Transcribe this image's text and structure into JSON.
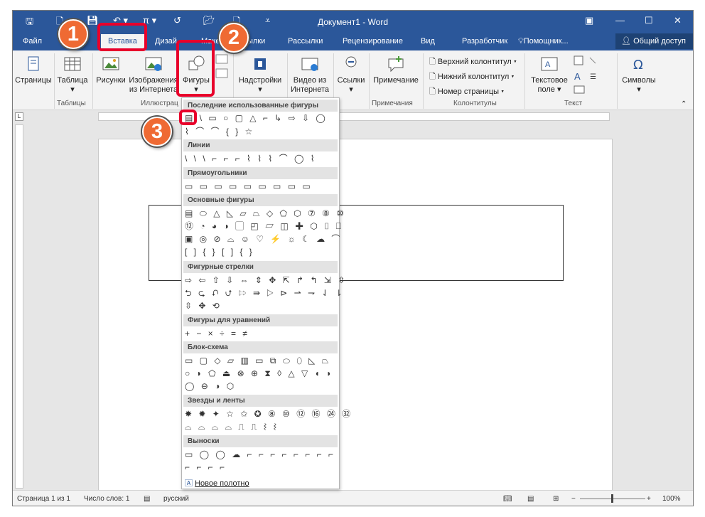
{
  "window": {
    "doc_title": "Документ1 - Word",
    "qat_icons": [
      "save-icon",
      "undo-icon",
      "paragraph-mark-icon",
      "redo-icon",
      "open-icon",
      "new-doc-icon",
      "customize-qat-icon"
    ]
  },
  "tabs": [
    {
      "label": "Файл"
    },
    {
      "label": "Вставка"
    },
    {
      "label": "Дизай"
    },
    {
      "label": "Маке"
    },
    {
      "label": "ылки"
    },
    {
      "label": "Рассылки"
    },
    {
      "label": "Рецензирование"
    },
    {
      "label": "Вид"
    },
    {
      "label": "Разработчик"
    },
    {
      "label": "Помощник..."
    }
  ],
  "share_label": "Общий доступ",
  "ribbon": {
    "pages": "Страницы",
    "table": "Таблица",
    "pictures": "Рисунки",
    "online_pictures_1": "Изображения",
    "online_pictures_2": "из Интернета",
    "shapes": "Фигуры",
    "addins": "Надстройки",
    "video_1": "Видео из",
    "video_2": "Интернета",
    "links": "Ссылки",
    "comment": "Примечание",
    "header": "Верхний колонтитул",
    "footer": "Нижний колонтитул",
    "page_number": "Номер страницы",
    "textbox_1": "Текстовое",
    "textbox_2": "поле",
    "symbols": "Символы",
    "groups": {
      "tables": "Таблицы",
      "illustrations": "Иллюстрац",
      "comments": "Примечания",
      "header_footer": "Колонтитулы",
      "text": "Текст"
    }
  },
  "shapes_menu": {
    "recent": "Последние использованные фигуры",
    "lines": "Линии",
    "rectangles": "Прямоугольники",
    "basic": "Основные фигуры",
    "arrows": "Фигурные стрелки",
    "equation": "Фигуры для уравнений",
    "flowchart": "Блок-схема",
    "stars": "Звезды и ленты",
    "callouts": "Выноски",
    "new_canvas": "Новое полотно",
    "glyphs": {
      "recent_1": "▤ \\ ▭ ○ ▢ △ ⌐ ↳ ⇨ ⇩ ◯",
      "recent_2": "⌇ ⌒ ⌒ { } ☆",
      "lines": "\\ \\ \\ ⌐ ⌐ ⌐ ⌇ ⌇ ⌇ ⌒ ◯ ⌇",
      "rects": "▭ ▭ ▭ ▭ ▭ ▭ ▭ ▭ ▭",
      "basic_1": "▤ ⬭ △ ◺ ▱ ⏢ ◇ ⬠ ⬡ ⑦ ⑧ ⑩",
      "basic_2": "⑫ ◔ ◕ ◑ ▢ ◰ ▱ ◫ ✚ ⬡ ⌷ ⎕",
      "basic_3": "▣ ◎ ⊘ ⌓ ☺ ♡ ⚡ ☼ ☾ ☁ ⌒",
      "basic_4": "[ ] { } [ ] { }",
      "arrows_1": "⇨ ⇦ ⇧ ⇩ ⇔ ⇕ ✥ ⇱ ↱ ↰ ⇲ ⇳",
      "arrows_2": "⮌ ⮎ ⮏ ⮍ ⇰ ⇛ ▷ ⊳ ⇀ ⇁ ⇃ ⇂",
      "arrows_3": "⇳ ✥ ⟲",
      "equation": "+ − × ÷ = ≠",
      "flow_1": "▭ ▢ ◇ ▱ ▥ ▭ ⧉ ⬭ ⬯ ◺ ⏢",
      "flow_2": "○ ◗ ⬠ ⏏ ⊗ ⊕ ⧗ ◊ △ ▽ ◖ ◗",
      "flow_3": "◯ ⊖ ◑ ⬡",
      "stars_1": "✸ ✹ ✦ ☆ ✩ ✪ ⑧ ⑩ ⑫ ⑯ ㉔ ㉜",
      "stars_2": "⌓ ⌓ ⌓ ⌓ ⎍ ⎍ ⌇ ⌇",
      "callouts_1": "▭ ◯ ◯ ☁ ⌐ ⌐ ⌐ ⌐ ⌐ ⌐ ⌐ ⌐",
      "callouts_2": "⌐ ⌐ ⌐ ⌐"
    }
  },
  "status": {
    "page": "Страница 1 из 1",
    "words": "Число слов: 1",
    "lang": "русский",
    "zoom": "100%"
  },
  "callouts": [
    "1",
    "2",
    "3"
  ],
  "colors": {
    "word_blue": "#2b579a",
    "callout_orange": "#ef6a33",
    "highlight_red": "#e8002b"
  }
}
